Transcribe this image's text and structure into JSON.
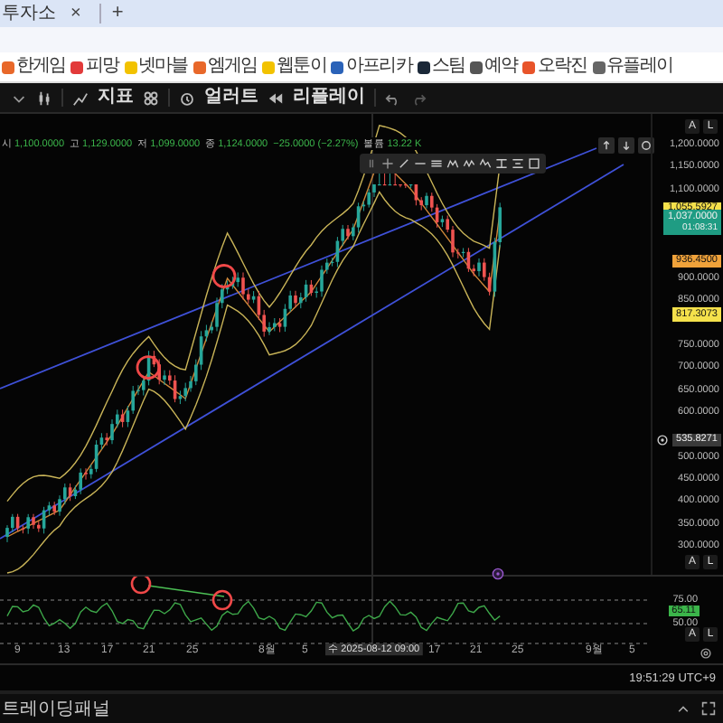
{
  "browser": {
    "tab": {
      "title": "투자소",
      "close": "×"
    },
    "new_tab": "+"
  },
  "bookmarks": [
    {
      "label": "한게임",
      "color": "#e8682a"
    },
    {
      "label": "피망",
      "color": "#e23a3a"
    },
    {
      "label": "넷마블",
      "color": "#f2c200"
    },
    {
      "label": "엠게임",
      "color": "#e8682a"
    },
    {
      "label": "웹툰이",
      "color": "#f2c200"
    },
    {
      "label": "아프리카",
      "color": "#2a62b8"
    },
    {
      "label": "스팀",
      "color": "#1b2838"
    },
    {
      "label": "예약",
      "color": "#555555"
    },
    {
      "label": "오락진",
      "color": "#e8542a"
    },
    {
      "label": "유플레이",
      "color": "#666666"
    }
  ],
  "toolbar": {
    "indicators": "지표",
    "alert": "얼러트",
    "replay": "리플레이"
  },
  "scale_buttons_top": [
    "A",
    "L"
  ],
  "legend": {
    "open": {
      "label": "시",
      "value": "1,100.0000"
    },
    "high": {
      "label": "고",
      "value": "1,129.0000"
    },
    "low": {
      "label": "저",
      "value": "1,099.0000"
    },
    "close": {
      "label": "종",
      "value": "1,124.0000"
    },
    "change": "−25.0000 (−2.27%)",
    "volume": {
      "label": "볼륨",
      "value": "13.22 K"
    }
  },
  "price_axis": {
    "ticks": [
      "1,200.0000",
      "1,150.0000",
      "1,100.0000",
      "900.0000",
      "850.0000",
      "750.0000",
      "700.0000",
      "650.0000",
      "600.0000",
      "500.0000",
      "450.0000",
      "400.0000",
      "350.0000",
      "300.0000"
    ],
    "badges": [
      {
        "value": "1,055.5927",
        "color": "#f5e14b"
      },
      {
        "value": "1,037.0000",
        "sub": "01:08:31",
        "color": "#1f9c83"
      },
      {
        "value": "936.4500",
        "color": "#f0a23a"
      },
      {
        "value": "817.3073",
        "color": "#f5e14b"
      },
      {
        "value": "535.8271",
        "color": "#3a3a3a"
      }
    ]
  },
  "scale_buttons_main": [
    "A",
    "L"
  ],
  "rsi": {
    "ticks": [
      "75.00",
      "50.00"
    ],
    "badge": {
      "value": "65.11",
      "color": "#3bb54a"
    },
    "scale_buttons": [
      "A",
      "L"
    ]
  },
  "time_axis": {
    "labels": [
      "9",
      "13",
      "17",
      "21",
      "25",
      "8월",
      "5",
      "17",
      "21",
      "25",
      "9월",
      "5"
    ],
    "cursor": "수 2025-08-12  09:00"
  },
  "status": {
    "clock": "19:51:29 UTC+9"
  },
  "panel": {
    "title": "트레이딩패널"
  }
}
